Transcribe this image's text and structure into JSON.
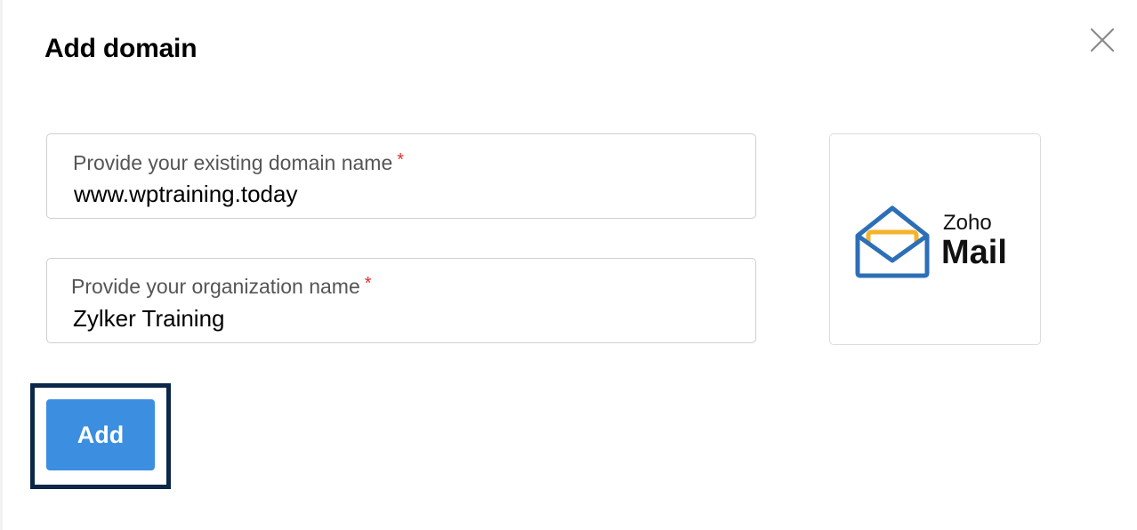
{
  "dialog": {
    "title": "Add domain",
    "close_icon": "close-icon"
  },
  "form": {
    "domain_field": {
      "label": "Provide your existing domain name",
      "required_mark": "*",
      "value": "www.wptraining.today"
    },
    "organization_field": {
      "label": "Provide your organization name",
      "required_mark": "*",
      "value": "Zylker Training"
    },
    "add_button_label": "Add"
  },
  "logo": {
    "brand_small": "Zoho",
    "brand_big": "Mail",
    "icon": "envelope-icon"
  },
  "colors": {
    "primary_button": "#3b8ee0",
    "highlight_border": "#0c2748",
    "required_mark": "#e0302c",
    "logo_blue": "#2d6fb7",
    "logo_yellow": "#f4b32a"
  }
}
